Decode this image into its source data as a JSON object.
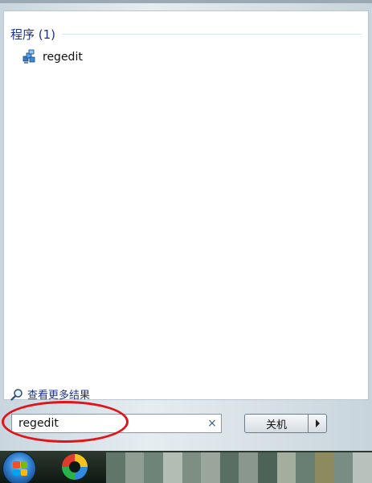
{
  "results": {
    "group_title": "程序 (1)",
    "items": [
      {
        "label": "regedit",
        "icon": "registry-editor-icon"
      }
    ],
    "see_more_label": "查看更多结果"
  },
  "search": {
    "value": "regedit",
    "clear_glyph": "×"
  },
  "shutdown": {
    "label": "关机"
  },
  "taskbar": {
    "start_icon": "windows-start-orb-icon",
    "pinned_app_icon": "colorful-app-icon"
  },
  "colors": {
    "group_title": "#1e3287",
    "annotation_circle": "#e0141b"
  }
}
